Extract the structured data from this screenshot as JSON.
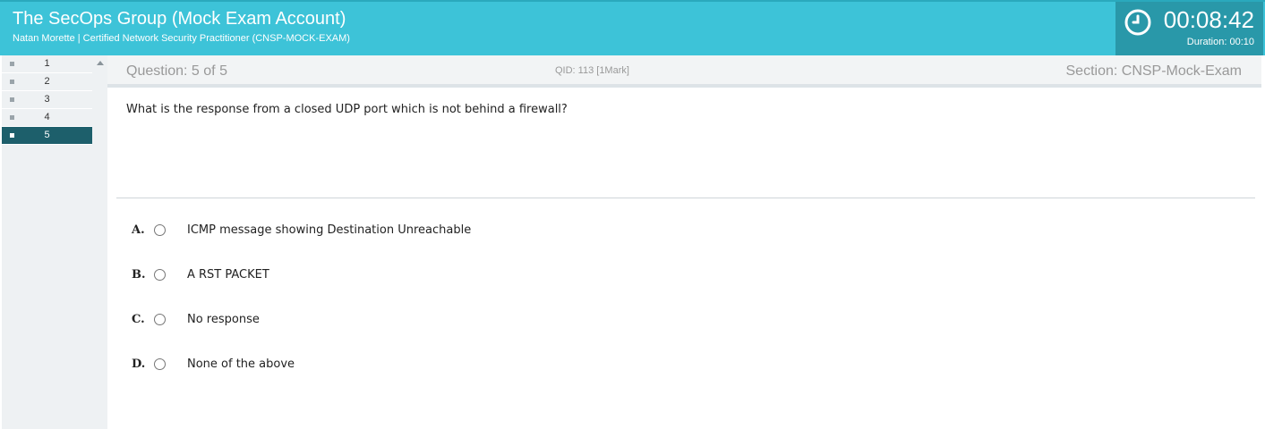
{
  "header": {
    "title": "The SecOps Group (Mock Exam Account)",
    "subtitle": "Natan Morette | Certified Network Security Practitioner (CNSP-MOCK-EXAM)",
    "timer": "00:08:42",
    "duration": "Duration: 00:10",
    "icon": "clock-icon"
  },
  "sidebar": {
    "questions": [
      "1",
      "2",
      "3",
      "4",
      "5"
    ],
    "active_index": 4
  },
  "question_bar": {
    "question_label": "Question: 5 of 5",
    "qid": "QID: 113  [1Mark]",
    "section": "Section:  CNSP-Mock-Exam"
  },
  "question": {
    "text": "What is the response from a closed UDP port which is not behind a firewall?"
  },
  "options": [
    {
      "letter": "A.",
      "text": "ICMP message showing Destination Unreachable"
    },
    {
      "letter": "B.",
      "text": "A RST PACKET"
    },
    {
      "letter": "C.",
      "text": "No response"
    },
    {
      "letter": "D.",
      "text": "None of the above"
    }
  ],
  "colors": {
    "header_bg": "#3dc3d8",
    "timer_bg": "#2998a9",
    "active_question_bg": "#1d5f6b"
  }
}
